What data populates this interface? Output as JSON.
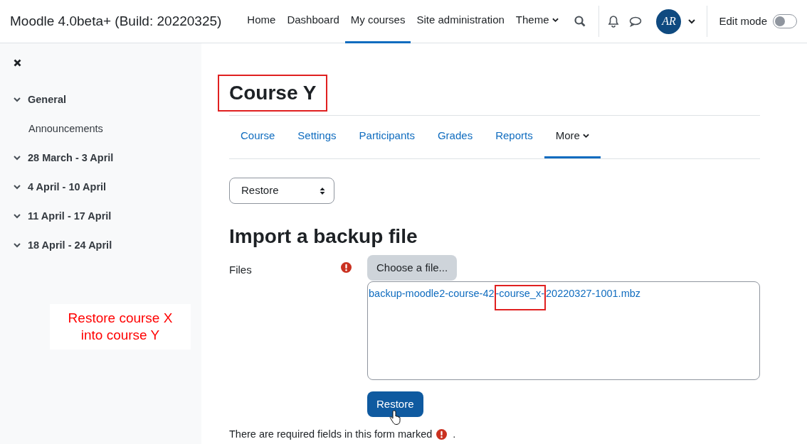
{
  "header": {
    "site_name": "Moodle 4.0beta+ (Build: 20220325)",
    "nav": [
      {
        "label": "Home",
        "selected": false,
        "dropdown": false
      },
      {
        "label": "Dashboard",
        "selected": false,
        "dropdown": false
      },
      {
        "label": "My courses",
        "selected": true,
        "dropdown": false
      },
      {
        "label": "Site administration",
        "selected": false,
        "dropdown": false
      },
      {
        "label": "Theme",
        "selected": false,
        "dropdown": true
      }
    ],
    "avatar_initials": "AR",
    "edit_mode": {
      "label": "Edit mode",
      "on": false
    }
  },
  "sidebar": {
    "sections": [
      {
        "label": "General",
        "expanded": true,
        "children": [
          {
            "label": "Announcements"
          }
        ]
      },
      {
        "label": "28 March - 3 April",
        "expanded": true
      },
      {
        "label": "4 April - 10 April",
        "expanded": true
      },
      {
        "label": "11 April - 17 April",
        "expanded": true
      },
      {
        "label": "18 April - 24 April",
        "expanded": true
      }
    ],
    "note": [
      "Restore course X",
      "into course Y"
    ]
  },
  "course_title": {
    "text": "Course Y",
    "highlighted": true
  },
  "tabs": [
    {
      "label": "Course",
      "selected": false,
      "dropdown": false
    },
    {
      "label": "Settings",
      "selected": false,
      "dropdown": false
    },
    {
      "label": "Participants",
      "selected": false,
      "dropdown": false
    },
    {
      "label": "Grades",
      "selected": false,
      "dropdown": false
    },
    {
      "label": "Reports",
      "selected": false,
      "dropdown": false
    },
    {
      "label": "More",
      "selected": true,
      "dropdown": true
    }
  ],
  "action_select": {
    "value": "Restore"
  },
  "form": {
    "heading": "Import a backup file",
    "field_label": "Files",
    "required": true,
    "choose_button": "Choose a file...",
    "file_name_parts": [
      {
        "text": "backup-moodle2-course-42",
        "highlighted": false
      },
      {
        "text": "-course_x-",
        "highlighted": true
      },
      {
        "text": "20220327-1001.mbz",
        "highlighted": false
      }
    ],
    "submit": "Restore",
    "required_note": "There are required fields in this form marked",
    "required_note_end": "."
  }
}
